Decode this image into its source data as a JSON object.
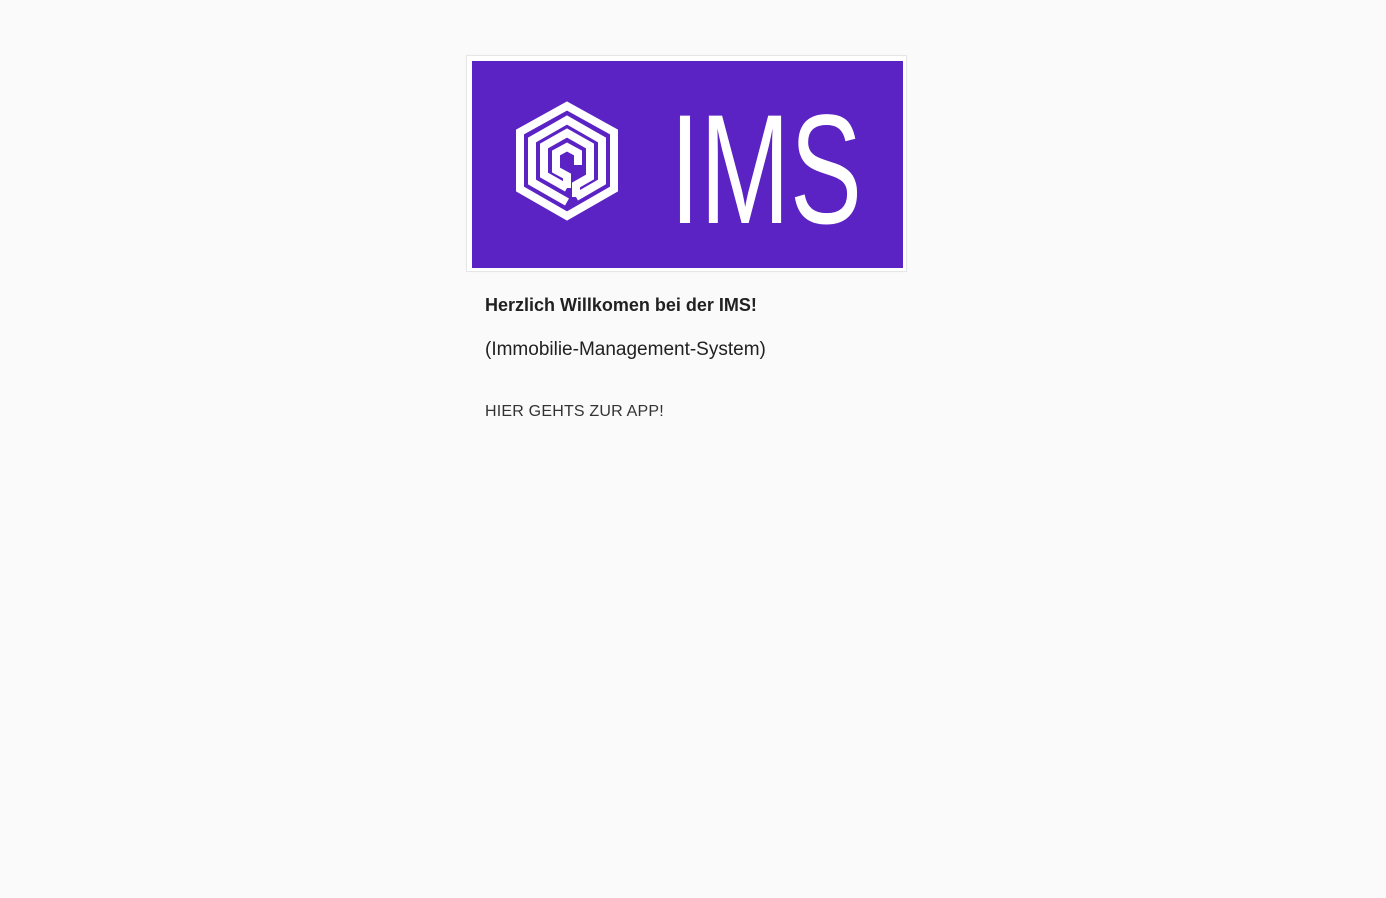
{
  "logo": {
    "wordmark": "IMS",
    "icon": "hexagon-spiral-icon",
    "background_color": "#5b22c4",
    "foreground_color": "#ffffff"
  },
  "welcome": {
    "title": "Herzlich Willkomen bei der IMS!",
    "subtitle": "(Immobilie-Management-System)"
  },
  "cta": {
    "label": "HIER GEHTS ZUR APP!"
  }
}
